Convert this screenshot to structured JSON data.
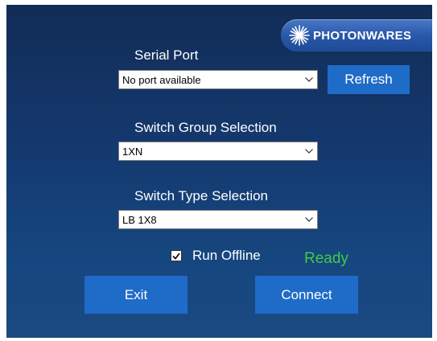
{
  "brand": {
    "logo_text": "PHOTONWARES",
    "logo_icon": "starburst-icon"
  },
  "serial_port": {
    "label": "Serial Port",
    "selected": "No port available",
    "refresh_label": "Refresh"
  },
  "switch_group": {
    "label": "Switch Group Selection",
    "selected": "1XN"
  },
  "switch_type": {
    "label": "Switch Type Selection",
    "selected": "LB 1X8"
  },
  "run_offline": {
    "label": "Run Offline",
    "checked": true
  },
  "status": {
    "text": "Ready",
    "color": "#3ecb4a"
  },
  "actions": {
    "exit_label": "Exit",
    "connect_label": "Connect"
  },
  "colors": {
    "button": "#1f6bc8",
    "background": "#143a70"
  }
}
